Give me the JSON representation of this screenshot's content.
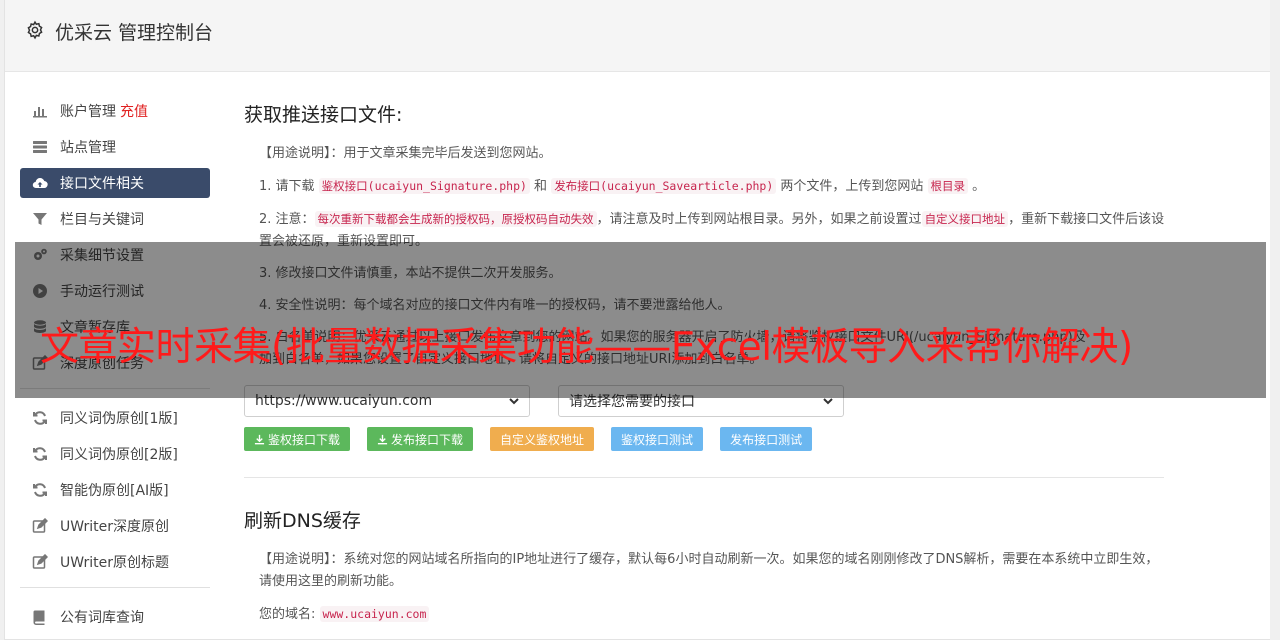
{
  "header": {
    "title": "优采云 管理控制台"
  },
  "sidebar": {
    "items": [
      {
        "label": "账户管理",
        "tag": "充值",
        "icon": "bar-chart-icon"
      },
      {
        "label": "站点管理",
        "icon": "server-icon"
      },
      {
        "label": "接口文件相关",
        "icon": "cloud-upload-icon",
        "active": true
      },
      {
        "label": "栏目与关键词",
        "icon": "filter-icon"
      },
      {
        "label": "采集细节设置",
        "icon": "cogs-icon"
      },
      {
        "label": "手动运行测试",
        "icon": "play-icon"
      },
      {
        "label": "文章暂存库",
        "icon": "database-icon"
      },
      {
        "label": "深度原创任务",
        "icon": "edit-icon"
      }
    ],
    "items2": [
      {
        "label": "同义词伪原创[1版]",
        "icon": "refresh-icon"
      },
      {
        "label": "同义词伪原创[2版]",
        "icon": "refresh-icon"
      },
      {
        "label": "智能伪原创[AI版]",
        "icon": "refresh-icon"
      },
      {
        "label": "UWriter深度原创",
        "icon": "edit-icon"
      },
      {
        "label": "UWriter原创标题",
        "icon": "edit-icon"
      }
    ],
    "items3": [
      {
        "label": "公有词库查询",
        "icon": "book-icon"
      }
    ]
  },
  "section1": {
    "title": "获取推送接口文件:",
    "usage": "【用途说明】：用于文章采集完毕后发送到您网站。",
    "p1_a": "1. 请下载 ",
    "p1_code1": "鉴权接口(ucaiyun_Signature.php)",
    "p1_b": " 和 ",
    "p1_code2": "发布接口(ucaiyun_Savearticle.php)",
    "p1_c": " 两个文件，上传到您网站 ",
    "p1_code3": "根目录",
    "p1_d": " 。",
    "p2_a": "2. 注意：",
    "p2_code1": "每次重新下载都会生成新的授权码，原授权码自动失效",
    "p2_b": "，请注意及时上传到网站根目录。另外，如果之前设置过",
    "p2_code2": "自定义接口地址",
    "p2_c": "，重新下载接口文件后该设置会被还原，重新设置即可。",
    "p3": "3. 修改接口文件请慎重，本站不提供二次开发服务。",
    "p4": "4. 安全性说明：每个域名对应的接口文件内有唯一的授权码，请不要泄露给他人。",
    "p5_a": "5. 白名单说明：优采云通过以上接口发布文章到您的网站。如果您的服务器开启了防火墙，请将鉴权接口文件URI(/ucaiyun_Signature.php)及",
    "p5_b": "加到白名单，如果您设置了自定义接口地址，请将自定义的接口地址URI添加到白名单。",
    "select_site": "https://www.ucaiyun.com",
    "select_api": "请选择您需要的接口",
    "btn1": "鉴权接口下载",
    "btn2": "发布接口下载",
    "btn3": "自定义鉴权地址",
    "btn4": "鉴权接口测试",
    "btn5": "发布接口测试"
  },
  "section2": {
    "title": "刷新DNS缓存",
    "usage": "【用途说明】：系统对您的网站域名所指向的IP地址进行了缓存，默认每6小时自动刷新一次。如果您的域名刚刚修改了DNS解析，需要在本系统中立即生效，请使用这里的刷新功能。",
    "domain_label": "您的域名:",
    "domain_value": "www.ucaiyun.com"
  },
  "overlay": {
    "text": "文章实时采集(批量数据采集功能——Excel模板导入来帮你解决)"
  },
  "colors": {
    "active_bg": "#3a4b6a",
    "green": "#5cb85c",
    "orange": "#f0ad4e",
    "blue": "#6bb7f0",
    "overlay_text": "#ff1a1a"
  }
}
